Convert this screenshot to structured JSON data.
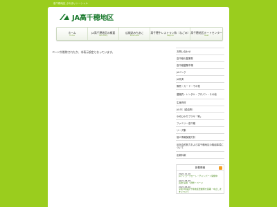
{
  "header": {
    "tagline": "高千穂地区 ぶれあいトーシャル",
    "logo_text": "JA高千穂地区"
  },
  "nav": [
    {
      "label": "ホーム",
      "sub": "Home"
    },
    {
      "label": "JA高千穂地区の概要",
      "sub": "Summary"
    },
    {
      "label": "広報誌みちあこ",
      "sub": "Kouhoushi"
    },
    {
      "label": "高千穂牛レストラン和（なごみ）",
      "sub": "Nagomi"
    },
    {
      "label": "高千穂地区ミートセンター",
      "sub": "Meat"
    }
  ],
  "main": {
    "notice": "ページが削除されたか、非表示設定となっています。"
  },
  "sidebar": {
    "items": [
      "お問い合わせ",
      "高千穂の農業祭",
      "高千穂農業市場",
      "JAバンク",
      "JA共済",
      "購買・カード・その他",
      "農機具・レンタル・プロパン・その他",
      "生産資材",
      "JA-SS（給油所）",
      "ゆめひかりプラザ「和」",
      "ファミリー高千穂",
      "リーダ集",
      "個人情報保護方針",
      "反社会的勢力および高千穂地区の取組事項について",
      "定款料款"
    ]
  },
  "news": {
    "title": "新着情報",
    "entries": [
      {
        "date": "2021.11.16",
        "text": "JAアイコープローレ・チャンパーン開催中"
      },
      {
        "date": "2021.05.28",
        "text": "直営 採用 ・研修・ページ"
      },
      {
        "date": "2021.05.20",
        "text": "令和3年度高千穂地区農業祭を延期・中止しますについて"
      }
    ]
  }
}
